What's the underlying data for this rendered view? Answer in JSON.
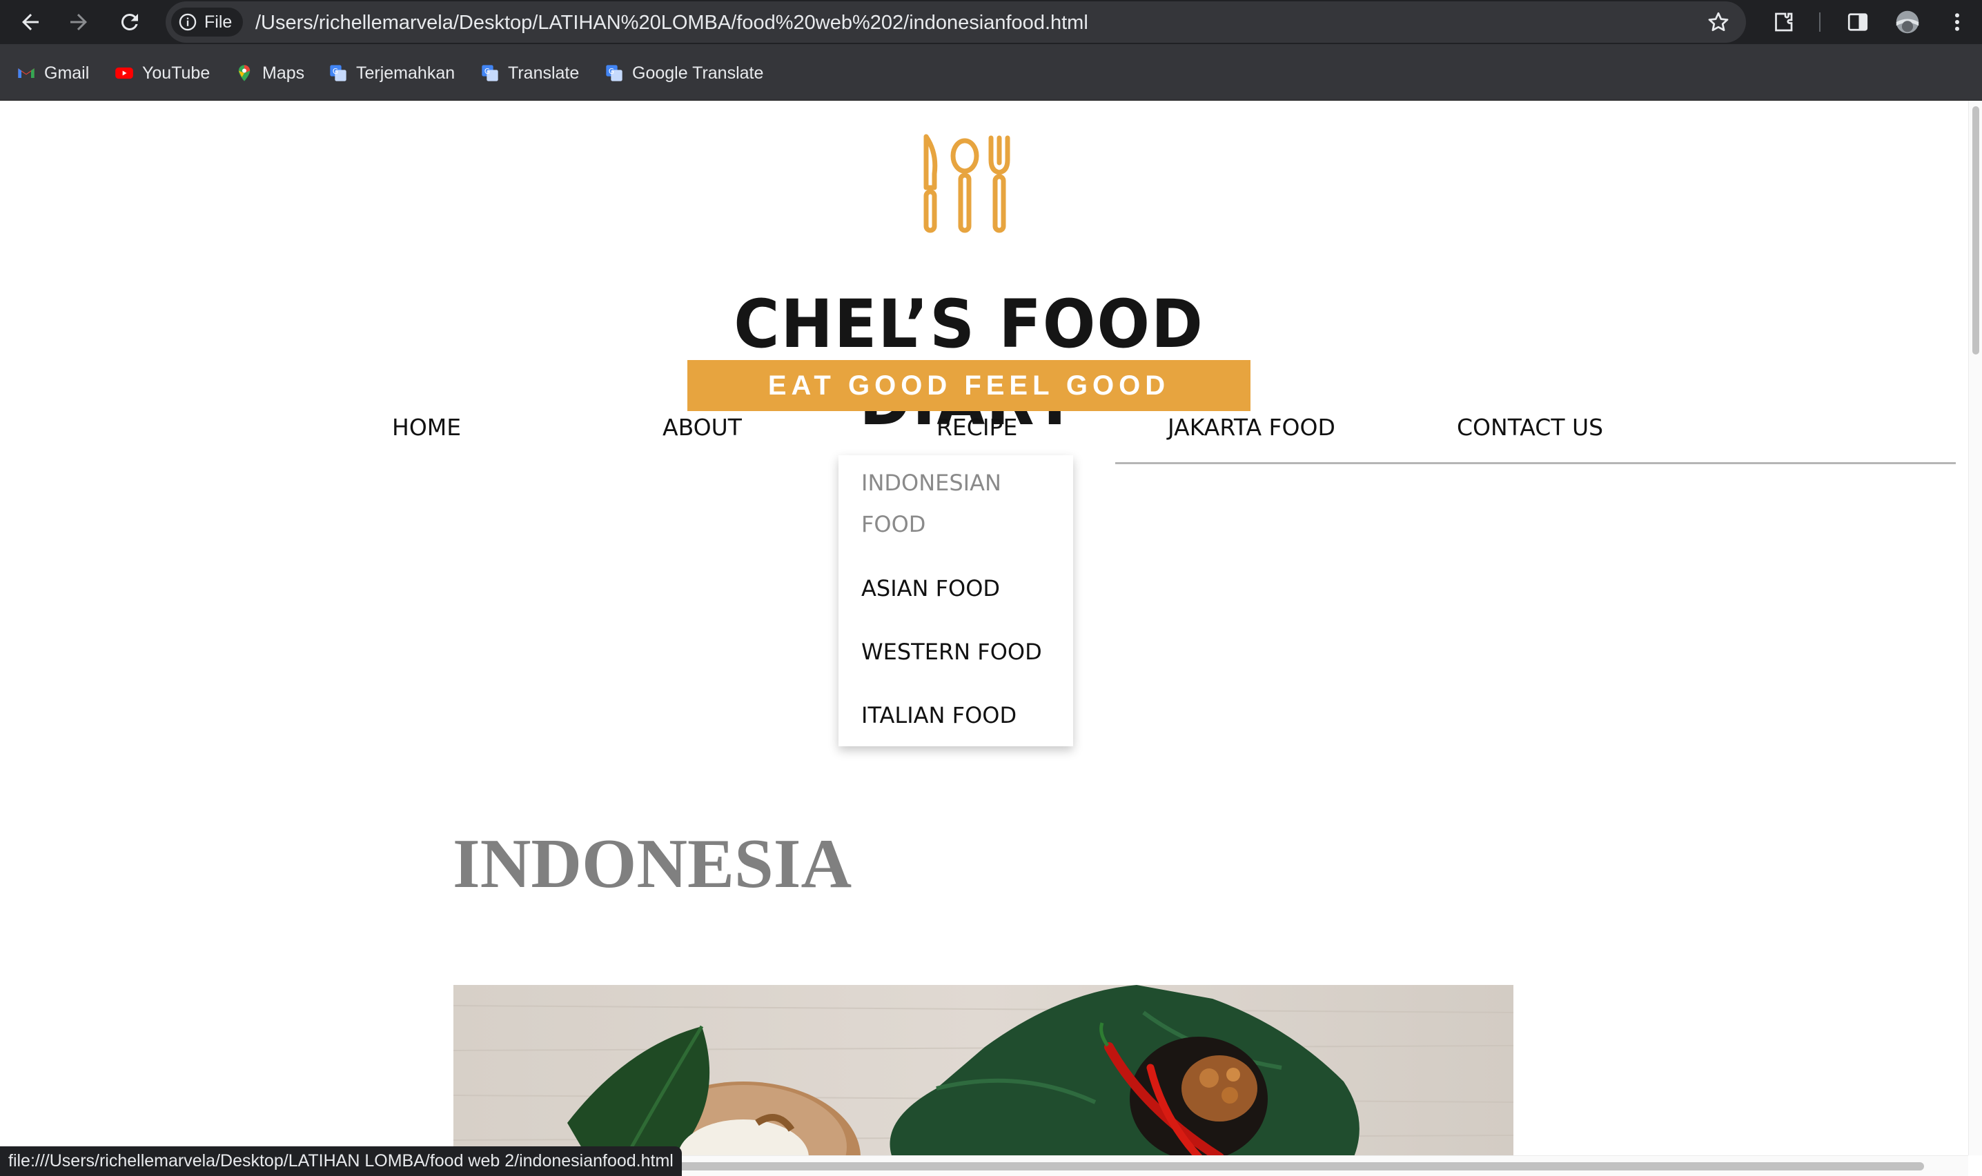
{
  "browser": {
    "chip_label": "File",
    "url": "/Users/richellemarvela/Desktop/LATIHAN%20LOMBA/food%20web%202/indonesianfood.html",
    "status_url": "file:///Users/richellemarvela/Desktop/LATIHAN LOMBA/food web 2/indonesianfood.html",
    "bookmarks": [
      {
        "label": "Gmail",
        "icon": "gmail-icon"
      },
      {
        "label": "YouTube",
        "icon": "youtube-icon"
      },
      {
        "label": "Maps",
        "icon": "maps-icon"
      },
      {
        "label": "Terjemahkan",
        "icon": "translate-icon"
      },
      {
        "label": "Translate",
        "icon": "translate-icon"
      },
      {
        "label": "Google Translate",
        "icon": "translate-icon"
      }
    ],
    "icons": [
      "back-icon",
      "forward-icon",
      "reload-icon",
      "info-icon",
      "star-icon",
      "extensions-icon",
      "side-panel-icon",
      "profile-avatar",
      "menu-icon"
    ]
  },
  "site": {
    "brand_name": "CHEL’S FOOD DIARY",
    "tagline": "EAT GOOD FEEL GOOD",
    "accent_color": "#e7a43f",
    "nav": [
      "HOME",
      "ABOUT",
      "RECIPE",
      "JAKARTA FOOD",
      "CONTACT US"
    ],
    "dropdown": [
      "INDONESIAN FOOD",
      "ASIAN FOOD",
      "WESTERN FOOD",
      "ITALIAN FOOD"
    ],
    "dropdown_active": "INDONESIAN FOOD",
    "heading": "INDONESIA"
  }
}
